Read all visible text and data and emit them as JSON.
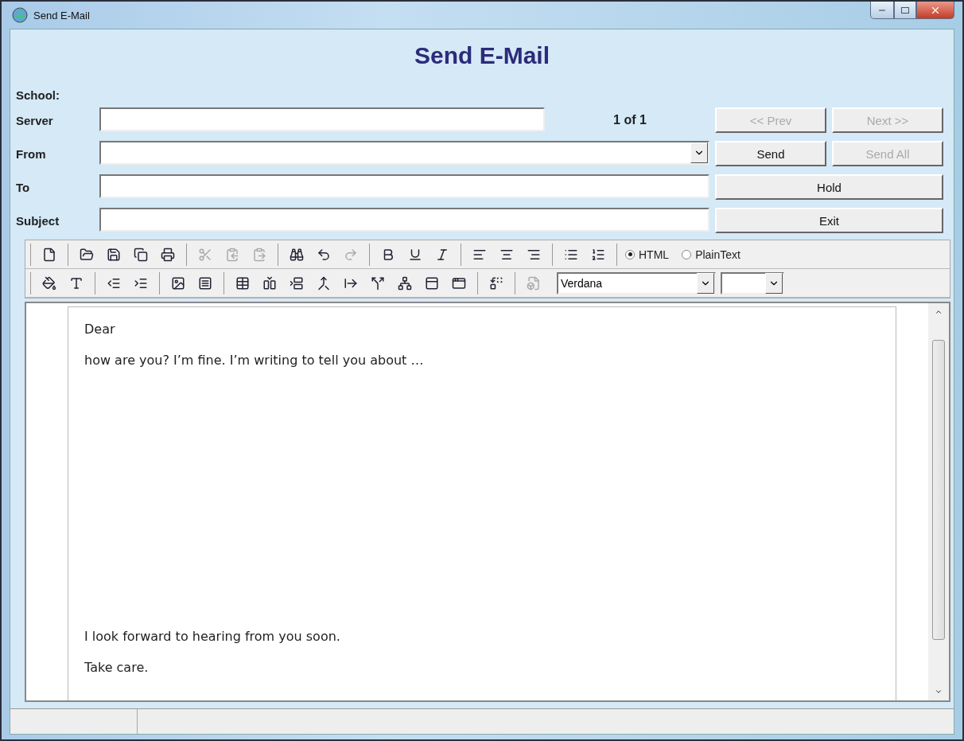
{
  "window": {
    "title": "Send E-Mail"
  },
  "heading": "Send E-Mail",
  "school_label": "School:",
  "fields": [
    {
      "label": "Server",
      "kind": "text"
    },
    {
      "label": "From",
      "kind": "combo"
    },
    {
      "label": "To",
      "kind": "text"
    },
    {
      "label": "Subject",
      "kind": "text"
    }
  ],
  "record_counter": "1 of 1",
  "buttons": [
    {
      "label": "<< Prev",
      "disabled": true,
      "wide": false
    },
    {
      "label": "Next >>",
      "disabled": true,
      "wide": false
    },
    {
      "label": "Send",
      "disabled": false,
      "wide": false
    },
    {
      "label": "Send All",
      "disabled": true,
      "wide": false
    },
    {
      "label": "Hold",
      "disabled": false,
      "wide": true
    },
    {
      "label": "Exit",
      "disabled": false,
      "wide": true
    }
  ],
  "toolbar_1": [
    [
      {
        "disabled": false
      }
    ],
    [
      {
        "disabled": false
      },
      {
        "disabled": false
      },
      {
        "disabled": false
      },
      {
        "disabled": false
      }
    ],
    [
      {
        "disabled": true
      },
      {
        "disabled": true
      },
      {
        "disabled": true
      }
    ],
    [
      {
        "disabled": false
      },
      {
        "disabled": false
      },
      {
        "disabled": true
      }
    ],
    [
      {
        "disabled": false
      },
      {
        "disabled": false
      },
      {
        "disabled": false
      }
    ],
    [
      {
        "disabled": false
      },
      {
        "disabled": false
      },
      {
        "disabled": false
      }
    ],
    [
      {
        "disabled": false
      },
      {
        "disabled": false
      }
    ]
  ],
  "format_options": [
    {
      "label": "HTML",
      "selected": true
    },
    {
      "label": "PlainText",
      "selected": false
    }
  ],
  "toolbar_2": [
    [
      {
        "disabled": false
      },
      {
        "disabled": false
      }
    ],
    [
      {
        "disabled": false
      },
      {
        "disabled": false
      }
    ],
    [
      {
        "disabled": false
      },
      {
        "disabled": false
      }
    ],
    [
      {
        "disabled": false
      },
      {
        "disabled": false
      },
      {
        "disabled": false
      },
      {
        "disabled": false
      },
      {
        "disabled": false
      },
      {
        "disabled": false
      },
      {
        "disabled": false
      },
      {
        "disabled": false
      },
      {
        "disabled": false
      }
    ],
    [
      {
        "disabled": false
      }
    ],
    [
      {
        "disabled": true
      }
    ]
  ],
  "font_select": {
    "value": "Verdana"
  },
  "editor": {
    "opening": [
      "Dear",
      "how are you? I’m fine. I’m writing to tell you about …"
    ],
    "closing": [
      "I look forward to hearing from you soon.",
      "Take care."
    ]
  }
}
